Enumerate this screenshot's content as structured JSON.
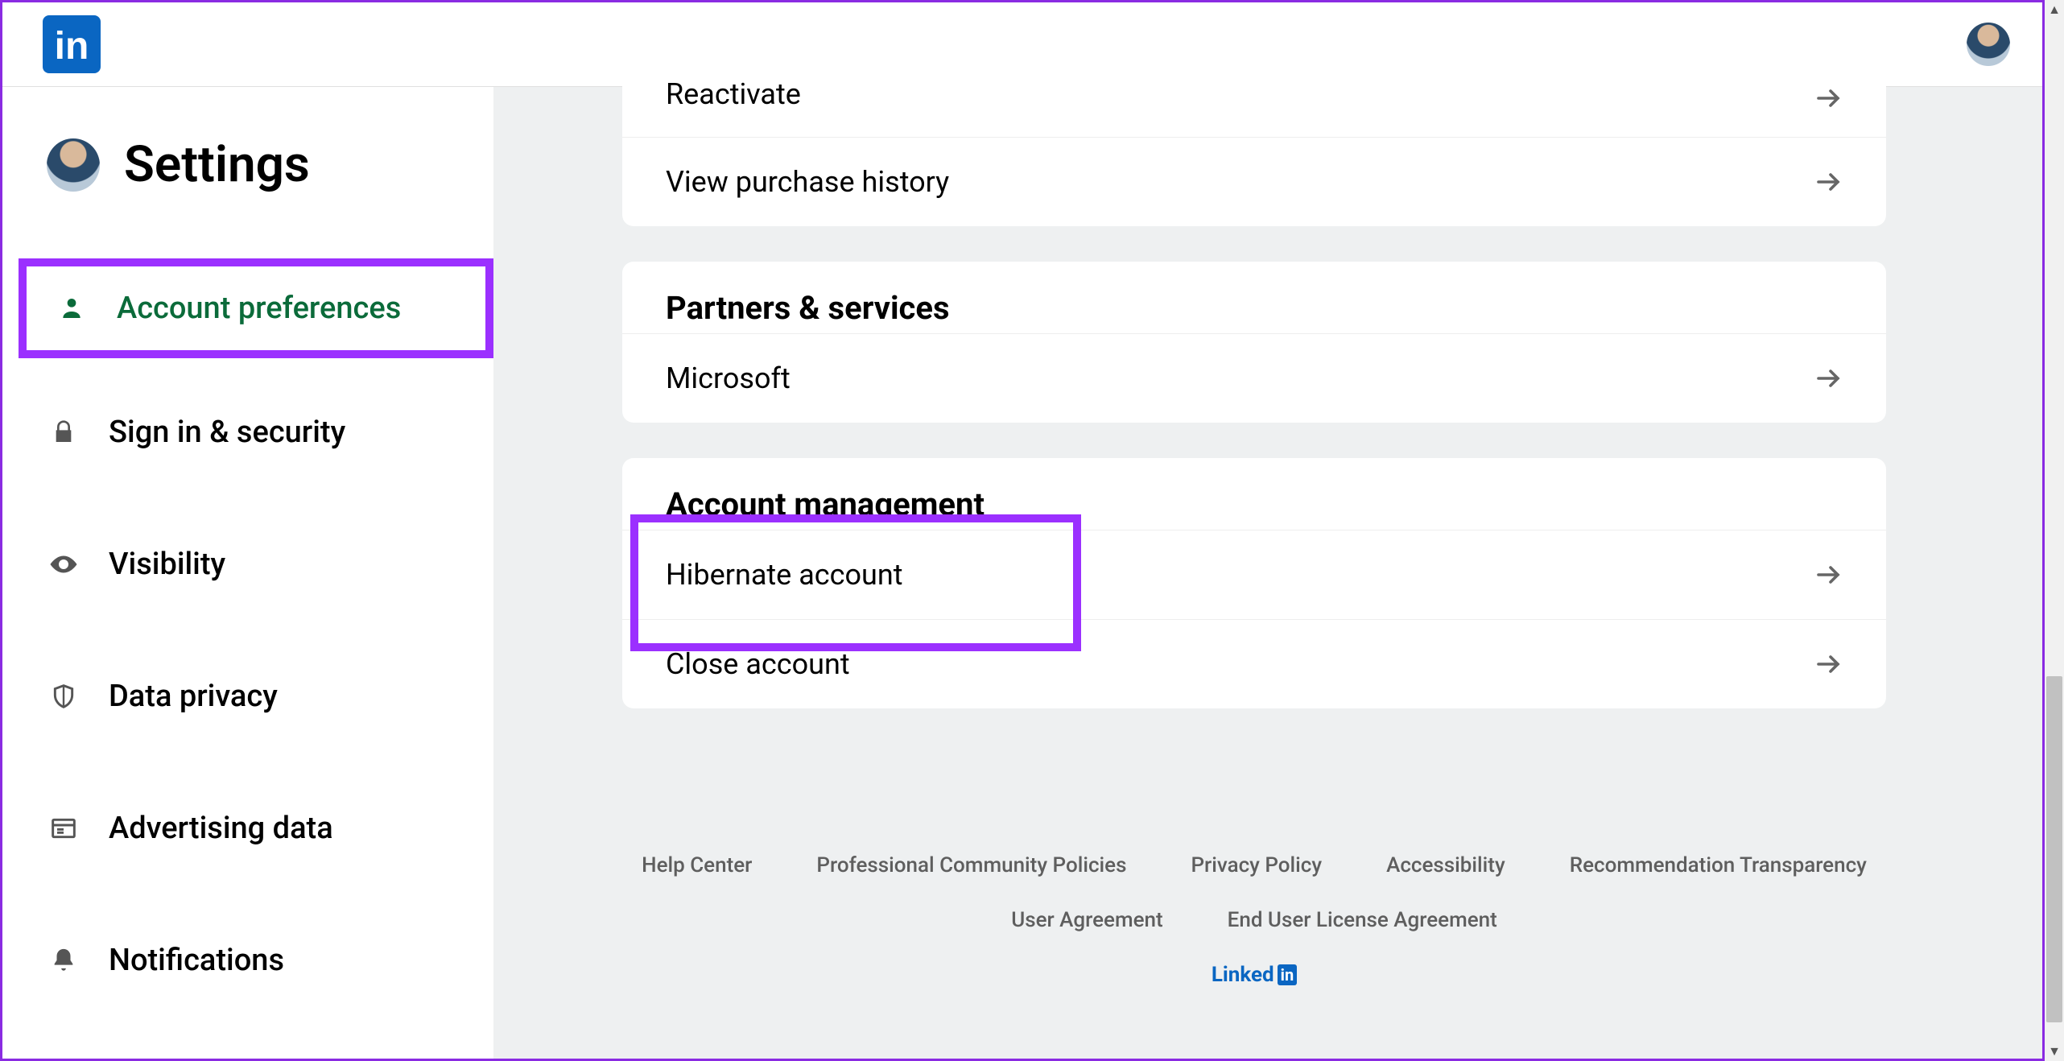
{
  "header": {
    "logo_text": "in"
  },
  "sidebar": {
    "title": "Settings",
    "items": [
      {
        "label": "Account preferences",
        "icon": "person-icon",
        "active": true
      },
      {
        "label": "Sign in & security",
        "icon": "lock-icon",
        "active": false
      },
      {
        "label": "Visibility",
        "icon": "eye-icon",
        "active": false
      },
      {
        "label": "Data privacy",
        "icon": "shield-icon",
        "active": false
      },
      {
        "label": "Advertising data",
        "icon": "newspaper-icon",
        "active": false
      },
      {
        "label": "Notifications",
        "icon": "bell-icon",
        "active": false
      }
    ]
  },
  "main": {
    "truncated_section": {
      "rows": [
        {
          "label": "Reactivate"
        },
        {
          "label": "View purchase history"
        }
      ]
    },
    "partners_section": {
      "heading": "Partners & services",
      "rows": [
        {
          "label": "Microsoft"
        }
      ]
    },
    "account_mgmt_section": {
      "heading": "Account management",
      "rows": [
        {
          "label": "Hibernate account"
        },
        {
          "label": "Close account"
        }
      ]
    }
  },
  "footer": {
    "links_row1": [
      "Help Center",
      "Professional Community Policies",
      "Privacy Policy",
      "Accessibility",
      "Recommendation Transparency"
    ],
    "links_row2": [
      "User Agreement",
      "End User License Agreement"
    ],
    "brand_prefix": "Linked",
    "brand_suffix": "in"
  }
}
